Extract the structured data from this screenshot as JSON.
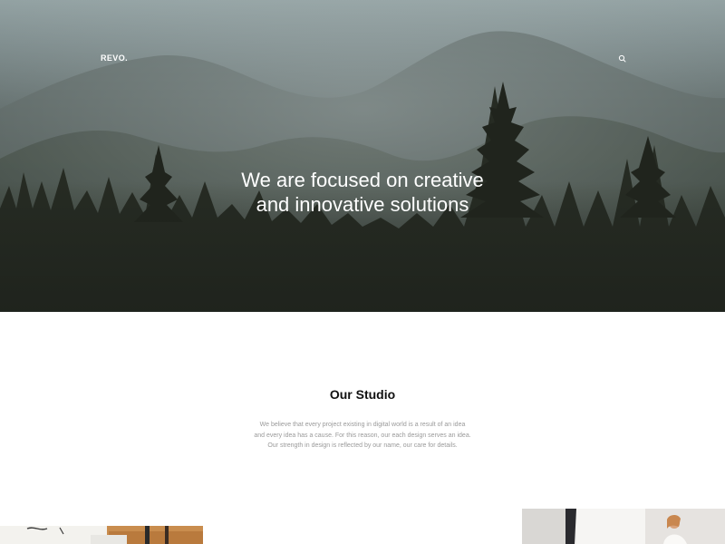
{
  "header": {
    "logo": "REVO.",
    "search_icon": "search-icon"
  },
  "hero": {
    "headline_line1": "We are focused on creative",
    "headline_line2": "and innovative solutions",
    "background": "misty-forest-mountains"
  },
  "studio": {
    "title": "Our Studio",
    "text_line1": "We believe that every project existing in digital world is a result of an idea",
    "text_line2": "and every idea has a cause. For this reason, our each design serves an idea.",
    "text_line3": "Our strength in design is reflected by our name, our care for details."
  },
  "colors": {
    "hero_top": "#93a2a3",
    "hero_bottom": "#24281f",
    "title": "#111111",
    "body_text": "#9a9a9a"
  }
}
